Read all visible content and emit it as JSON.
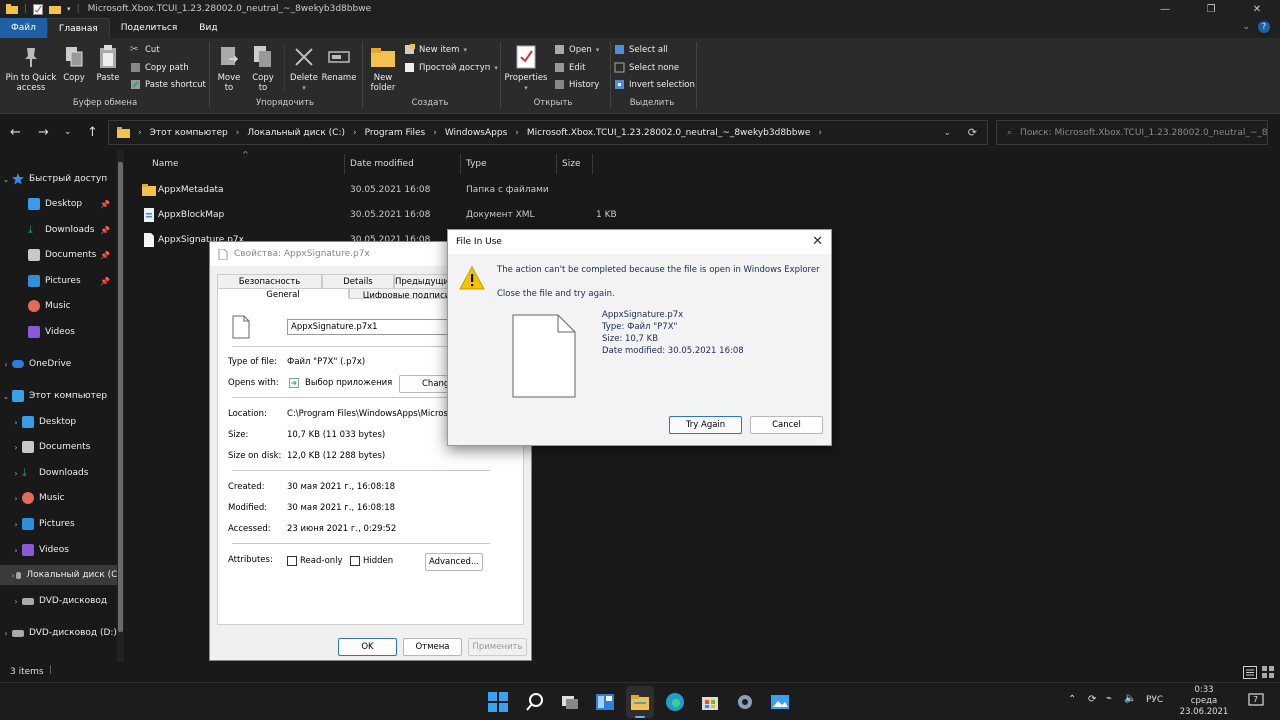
{
  "window": {
    "title": "Microsoft.Xbox.TCUI_1.23.28002.0_neutral_~_8wekyb3d8bbwe",
    "controls": [
      "minimize-icon",
      "maximize-icon",
      "close-icon"
    ]
  },
  "menu_tabs": [
    "Файл",
    "Главная",
    "Поделиться",
    "Вид"
  ],
  "ribbon": {
    "clipboard": {
      "pin": "Pin to Quick access",
      "copy": "Copy",
      "paste": "Paste",
      "cut": "Cut",
      "copy_path": "Copy path",
      "paste_shortcut": "Paste shortcut",
      "group": "Буфер обмена"
    },
    "organize": {
      "move": "Move to",
      "copy": "Copy to",
      "delete": "Delete",
      "rename": "Rename",
      "group": "Упорядочить"
    },
    "new": {
      "folder": "New folder",
      "item": "New item",
      "easy_access": "Простой доступ",
      "group": "Создать"
    },
    "open": {
      "properties": "Properties",
      "open": "Open",
      "edit": "Edit",
      "history": "History",
      "group": "Открыть"
    },
    "select": {
      "all": "Select all",
      "none": "Select none",
      "invert": "Invert selection",
      "group": "Выделить"
    }
  },
  "address": {
    "path": [
      "Этот компьютер",
      "Локальный диск (C:)",
      "Program Files",
      "WindowsApps",
      "Microsoft.Xbox.TCUI_1.23.28002.0_neutral_~_8wekyb3d8bbwe"
    ],
    "search_placeholder": "Поиск: Microsoft.Xbox.TCUI_1.23.28002.0_neutral_~_8..."
  },
  "nav": {
    "quick": "Быстрый доступ",
    "quick_items": [
      "Desktop",
      "Downloads",
      "Documents",
      "Pictures",
      "Music",
      "Videos"
    ],
    "onedrive": "OneDrive",
    "pc": "Этот компьютер",
    "pc_items": [
      "Desktop",
      "Documents",
      "Downloads",
      "Music",
      "Pictures",
      "Videos",
      "Локальный диск (C:)",
      "DVD-дисковод"
    ],
    "dvd": "DVD-дисковод (D:)"
  },
  "columns": {
    "name": "Name",
    "date": "Date modified",
    "type": "Type",
    "size": "Size"
  },
  "files": [
    {
      "name": "AppxMetadata",
      "date": "30.05.2021 16:08",
      "type": "Папка с файлами",
      "size": ""
    },
    {
      "name": "AppxBlockMap",
      "date": "30.05.2021 16:08",
      "type": "Документ XML",
      "size": "1 KB"
    },
    {
      "name": "AppxSignature.p7x",
      "date": "30.05.2021 16:08",
      "type": "",
      "size": ""
    }
  ],
  "status": {
    "items": "3 items"
  },
  "properties": {
    "title": "Свойства: AppxSignature.p7x",
    "tabs_top": [
      "Безопасность",
      "Details",
      "Предыдущие версии"
    ],
    "tabs_bottom": [
      "General",
      "Цифровые подписи"
    ],
    "filename": "AppxSignature.p7x1",
    "type_label": "Type of file:",
    "type_value": "Файл \"P7X\" (.p7x)",
    "opens_label": "Opens with:",
    "opens_value": "Выбор приложения",
    "change": "Change...",
    "location_label": "Location:",
    "location_value": "C:\\Program Files\\WindowsApps\\Microsoft.Xbox.TCUI_1.23.28002.0",
    "size_label": "Size:",
    "size_value": "10,7 KB (11 033 bytes)",
    "disk_label": "Size on disk:",
    "disk_value": "12,0 KB (12 288 bytes)",
    "created_label": "Created:",
    "created_value": "30 мая 2021 г., 16:08:18",
    "modified_label": "Modified:",
    "modified_value": "30 мая 2021 г., 16:08:18",
    "accessed_label": "Accessed:",
    "accessed_value": "23 июня 2021 г., 0:29:52",
    "attributes_label": "Attributes:",
    "readonly": "Read-only",
    "hidden": "Hidden",
    "advanced": "Advanced...",
    "ok": "OK",
    "cancel": "Отмена",
    "apply": "Применить"
  },
  "file_in_use": {
    "title": "File In Use",
    "message": "The action can't be completed because the file is open in Windows Explorer",
    "instruction": "Close the file and try again.",
    "file_name": "AppxSignature.p7x",
    "file_type": "Type: Файл \"P7X\"",
    "file_size": "Size: 10,7 KB",
    "file_date": "Date modified: 30.05.2021 16:08",
    "try_again": "Try Again",
    "cancel": "Cancel"
  },
  "taskbar": {
    "lang": "РУС",
    "time": "0:33",
    "day": "среда",
    "date": "23.06.2021",
    "notifications": "7"
  },
  "colors": {
    "accent": "#1f5fa6",
    "folder": "#f2c14e",
    "warning": "#f5c400"
  }
}
